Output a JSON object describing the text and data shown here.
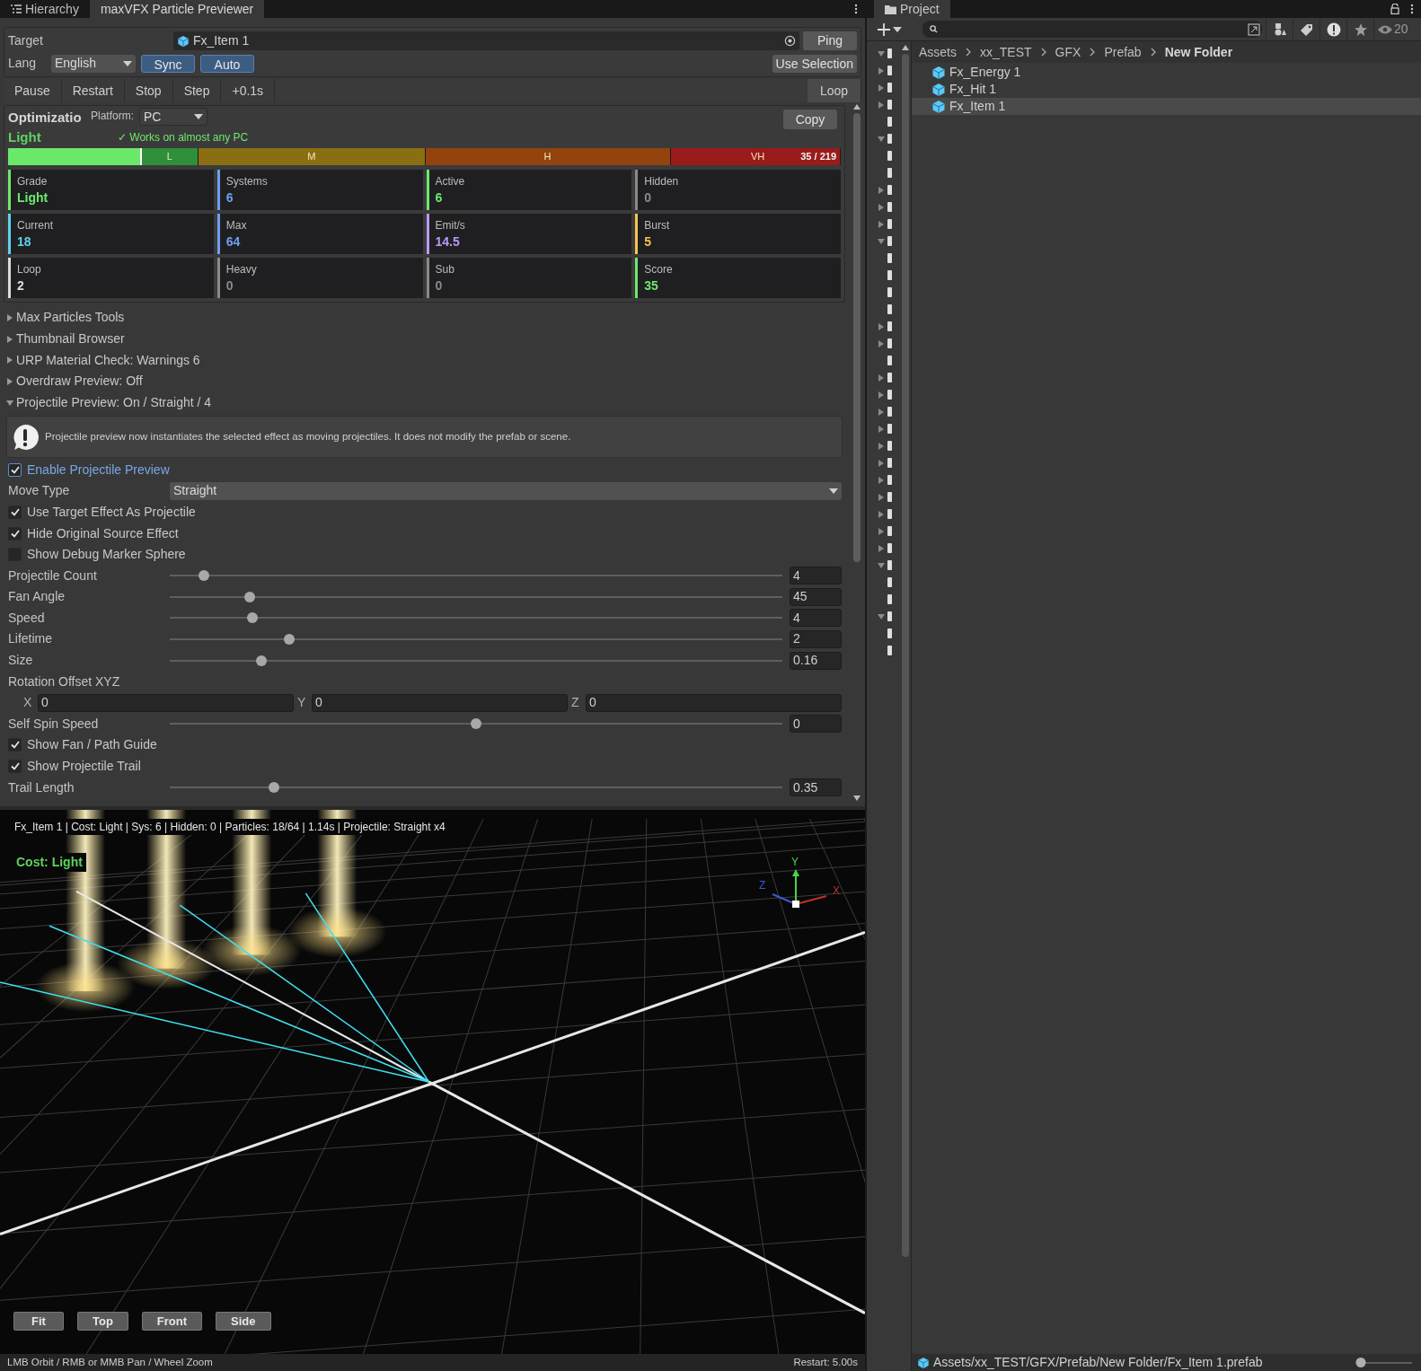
{
  "left_tabs": [
    {
      "label": "Hierarchy",
      "selected": false,
      "kind": "list"
    },
    {
      "label": "maxVFX Particle Previewer",
      "selected": true,
      "kind": "plain"
    }
  ],
  "target": {
    "label": "Target",
    "value": "Fx_Item 1",
    "button": "Ping"
  },
  "lang": {
    "label": "Lang",
    "value": "English",
    "toggles": [
      {
        "label": "Sync",
        "on": true
      },
      {
        "label": "Auto",
        "on": true
      }
    ],
    "button": "Use Selection"
  },
  "playback": [
    {
      "label": "Pause",
      "on": false
    },
    {
      "label": "Restart",
      "on": false
    },
    {
      "label": "Stop",
      "on": false
    },
    {
      "label": "Step",
      "on": false
    },
    {
      "label": "+0.1s",
      "on": false
    },
    {
      "label": "Loop",
      "on": true
    }
  ],
  "optimizer": {
    "title": "Optimizatio",
    "platform_label": "Platform:",
    "platform": "PC",
    "copy": "Copy",
    "grade": "Light",
    "note": "✓ Works on almost any PC",
    "cost_bar": {
      "level": 0.16,
      "reading": "35 / 219",
      "segments": [
        {
          "label": "L",
          "color": "#2f8f3a"
        },
        {
          "label": "M",
          "color": "#8a6f12"
        },
        {
          "label": "H",
          "color": "#94430f"
        },
        {
          "label": "VH",
          "color": "#9a1b1b"
        }
      ]
    },
    "stats": [
      {
        "label": "Grade",
        "value": "Light",
        "color": "#6ee86e"
      },
      {
        "label": "Systems",
        "value": "6",
        "color": "#6f9ff0"
      },
      {
        "label": "Active",
        "value": "6",
        "color": "#6ee86e"
      },
      {
        "label": "Hidden",
        "value": "0",
        "color": "#8a8a8a"
      },
      {
        "label": "Current",
        "value": "18",
        "color": "#5fd3f0"
      },
      {
        "label": "Max",
        "value": "64",
        "color": "#6f9ff0"
      },
      {
        "label": "Emit/s",
        "value": "14.5",
        "color": "#b79af5"
      },
      {
        "label": "Burst",
        "value": "5",
        "color": "#f5c451"
      },
      {
        "label": "Loop",
        "value": "2",
        "color": "#dcdcdc"
      },
      {
        "label": "Heavy",
        "value": "0",
        "color": "#8a8a8a"
      },
      {
        "label": "Sub",
        "value": "0",
        "color": "#8a8a8a"
      },
      {
        "label": "Score",
        "value": "35",
        "color": "#6ee86e"
      }
    ]
  },
  "foldouts": [
    {
      "label": "Max Particles Tools",
      "expanded": false
    },
    {
      "label": "Thumbnail Browser",
      "expanded": false
    },
    {
      "label": "URP Material Check: Warnings 6",
      "expanded": false
    },
    {
      "label": "Overdraw Preview: Off",
      "expanded": false
    },
    {
      "label": "Projectile Preview: On / Straight / 4",
      "expanded": true
    }
  ],
  "info": "Projectile preview now instantiates the selected effect as moving projectiles. It does not modify the prefab or scene.",
  "controls": [
    {
      "kind": "checkbox",
      "label": "Enable Projectile Preview",
      "checked": true,
      "focused": true
    },
    {
      "kind": "dropdown",
      "label": "Move Type",
      "value": "Straight"
    },
    {
      "kind": "checkbox",
      "label": "Use Target Effect As Projectile",
      "checked": true,
      "focused": false
    },
    {
      "kind": "checkbox",
      "label": "Hide Original Source Effect",
      "checked": true,
      "focused": false
    },
    {
      "kind": "checkbox",
      "label": "Show Debug Marker Sphere",
      "checked": false,
      "focused": false
    },
    {
      "kind": "slider",
      "label": "Projectile Count",
      "level": 0.055,
      "value": "4"
    },
    {
      "kind": "slider",
      "label": "Fan Angle",
      "level": 0.13,
      "value": "45"
    },
    {
      "kind": "slider",
      "label": "Speed",
      "level": 0.135,
      "value": "4"
    },
    {
      "kind": "slider",
      "label": "Lifetime",
      "level": 0.195,
      "value": "2"
    },
    {
      "kind": "slider",
      "label": "Size",
      "level": 0.15,
      "value": "0.16"
    },
    {
      "kind": "heading",
      "label": "Rotation Offset XYZ"
    },
    {
      "kind": "vector3",
      "axes": [
        {
          "label": "X",
          "value": "0"
        },
        {
          "label": "Y",
          "value": "0"
        },
        {
          "label": "Z",
          "value": "0"
        }
      ]
    },
    {
      "kind": "slider",
      "label": "Self Spin Speed",
      "level": 0.5,
      "value": "0"
    },
    {
      "kind": "checkbox",
      "label": "Show Fan / Path Guide",
      "checked": true,
      "focused": false
    },
    {
      "kind": "checkbox",
      "label": "Show Projectile Trail",
      "checked": true,
      "focused": false
    },
    {
      "kind": "slider",
      "label": "Trail Length",
      "level": 0.17,
      "value": "0.35"
    }
  ],
  "viewport": {
    "info": "Fx_Item 1 | Cost: Light | Sys: 6 | Hidden: 0 | Particles: 18/64 | 1.14s | Projectile: Straight x4",
    "cost": "Cost: Light",
    "gizmo": {
      "y": "Y",
      "x": "X",
      "z": "Z"
    },
    "view_buttons": [
      "Fit",
      "Top",
      "Front",
      "Side"
    ],
    "hint": "LMB Orbit / RMB or MMB Pan / Wheel Zoom",
    "restart": "Restart: 5.00s"
  },
  "project": {
    "tab": "Project",
    "visible_count": "20",
    "tree": [
      {
        "kind": "folder",
        "expanded": true
      },
      {
        "kind": "folder",
        "expanded": false
      },
      {
        "kind": "folder",
        "expanded": false
      },
      {
        "kind": "folder",
        "expanded": false
      },
      {
        "kind": "leaf"
      },
      {
        "kind": "folder",
        "expanded": true
      },
      {
        "kind": "leaf"
      },
      {
        "kind": "leaf"
      },
      {
        "kind": "folder",
        "expanded": false
      },
      {
        "kind": "folder",
        "expanded": false
      },
      {
        "kind": "folder",
        "expanded": false
      },
      {
        "kind": "folder",
        "expanded": true
      },
      {
        "kind": "leaf"
      },
      {
        "kind": "leaf"
      },
      {
        "kind": "leaf"
      },
      {
        "kind": "leaf"
      },
      {
        "kind": "folder",
        "expanded": false
      },
      {
        "kind": "folder",
        "expanded": false
      },
      {
        "kind": "leaf"
      },
      {
        "kind": "folder",
        "expanded": false
      },
      {
        "kind": "folder",
        "expanded": false
      },
      {
        "kind": "folder",
        "expanded": false
      },
      {
        "kind": "folder",
        "expanded": false
      },
      {
        "kind": "folder",
        "expanded": false
      },
      {
        "kind": "folder",
        "expanded": false
      },
      {
        "kind": "folder",
        "expanded": false
      },
      {
        "kind": "folder",
        "expanded": false
      },
      {
        "kind": "folder",
        "expanded": false
      },
      {
        "kind": "folder",
        "expanded": false
      },
      {
        "kind": "folder",
        "expanded": false
      },
      {
        "kind": "folder",
        "expanded": true
      },
      {
        "kind": "leaf"
      },
      {
        "kind": "leaf"
      },
      {
        "kind": "folder",
        "expanded": true
      },
      {
        "kind": "leaf"
      },
      {
        "kind": "leaf"
      }
    ],
    "breadcrumbs": [
      "Assets",
      "xx_TEST",
      "GFX",
      "Prefab",
      "New Folder"
    ],
    "items": [
      {
        "name": "Fx_Energy 1",
        "selected": false
      },
      {
        "name": "Fx_Hit 1",
        "selected": false
      },
      {
        "name": "Fx_Item 1",
        "selected": true
      }
    ],
    "path": "Assets/xx_TEST/GFX/Prefab/New Folder/Fx_Item 1.prefab",
    "zoom": {
      "level": 0.08
    }
  }
}
